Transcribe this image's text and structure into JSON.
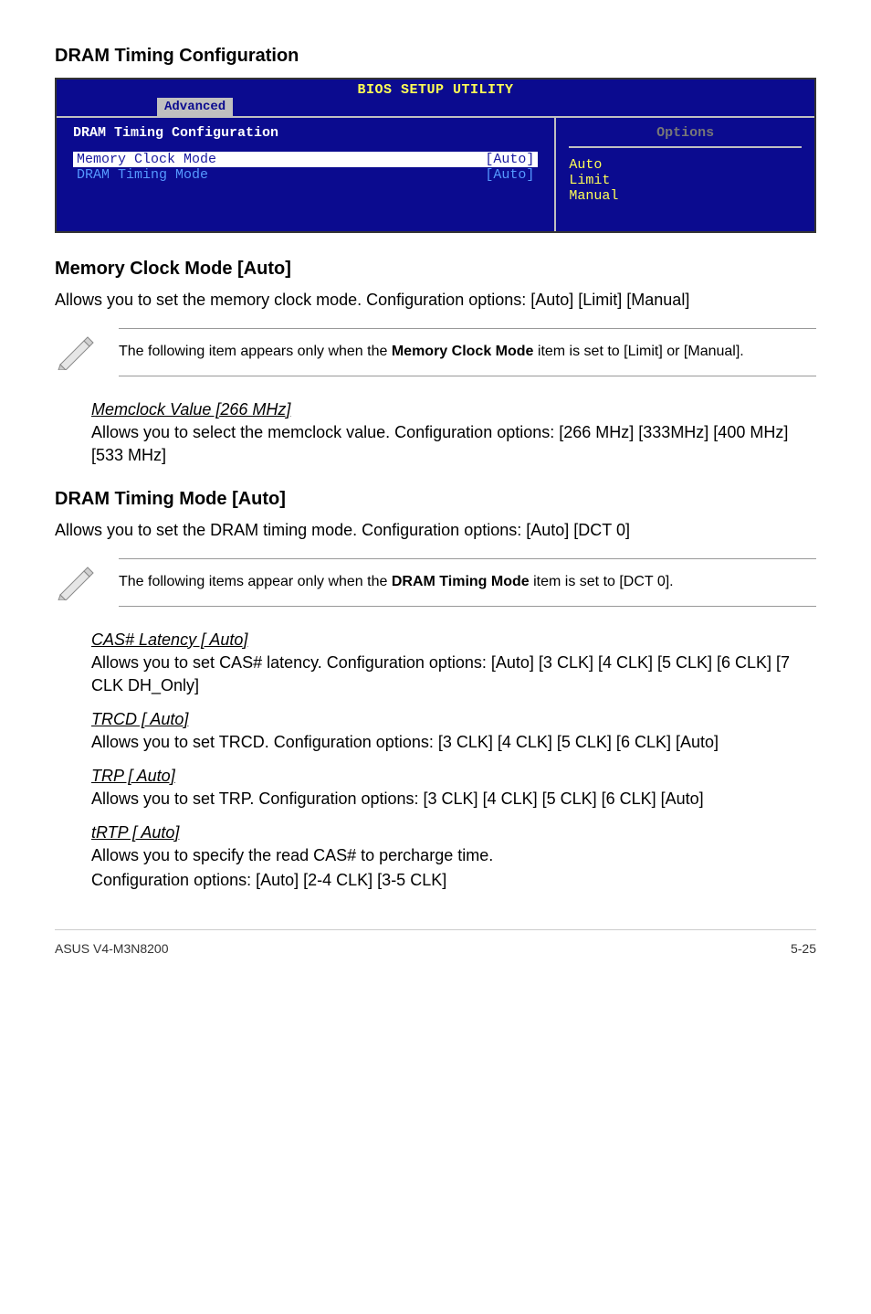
{
  "page": {
    "h2_1": "DRAM Timing Configuration",
    "h2_2": "Memory Clock Mode [Auto]",
    "h2_3": "DRAM Timing Mode [Auto]"
  },
  "bios": {
    "title": "BIOS SETUP UTILITY",
    "tab": "Advanced",
    "heading": "DRAM Timing Configuration",
    "rows": [
      {
        "label": "Memory Clock Mode",
        "value": "[Auto]"
      },
      {
        "label": "DRAM Timing Mode",
        "value": "[Auto]"
      }
    ],
    "options_header": "Options",
    "options": [
      "Auto",
      "Limit",
      "Manual"
    ]
  },
  "body": {
    "memclock_mode_desc": "Allows you to set the memory clock mode. Configuration options: [Auto] [Limit] [Manual]",
    "dram_timing_desc": "Allows you to set the DRAM timing mode. Configuration options: [Auto] [DCT 0]"
  },
  "notes": {
    "note1_a": "The following item appears only when the ",
    "note1_b": "Memory Clock Mode",
    "note1_c": " item is set to [Limit] or [Manual].",
    "note2_a": "The following items appear only when the ",
    "note2_b": "DRAM Timing Mode",
    "note2_c": " item is set to [DCT 0]."
  },
  "subs": {
    "memclock_label": "Memclock Value [266 MHz]",
    "memclock_text": "Allows you to select the memclock value. Configuration options: [266 MHz] [333MHz] [400 MHz] [533 MHz]",
    "cas_label": "CAS# Latency [ Auto]",
    "cas_text": "Allows you to set CAS# latency. Configuration options: [Auto] [3 CLK] [4 CLK] [5 CLK] [6 CLK] [7 CLK DH_Only]",
    "trcd_label": "TRCD [ Auto]",
    "trcd_text": "Allows you to set TRCD. Configuration options: [3 CLK] [4 CLK] [5 CLK] [6 CLK] [Auto]",
    "trp_label": "TRP [ Auto]",
    "trp_text": "Allows you to set TRP. Configuration options: [3 CLK] [4 CLK] [5 CLK] [6 CLK] [Auto]",
    "trtp_label": "tRTP [ Auto]",
    "trtp_text1": "Allows you to specify the read CAS# to percharge time.",
    "trtp_text2": "Configuration options: [Auto] [2-4 CLK] [3-5 CLK]"
  },
  "footer": {
    "left": "ASUS V4-M3N8200",
    "right": "5-25"
  }
}
